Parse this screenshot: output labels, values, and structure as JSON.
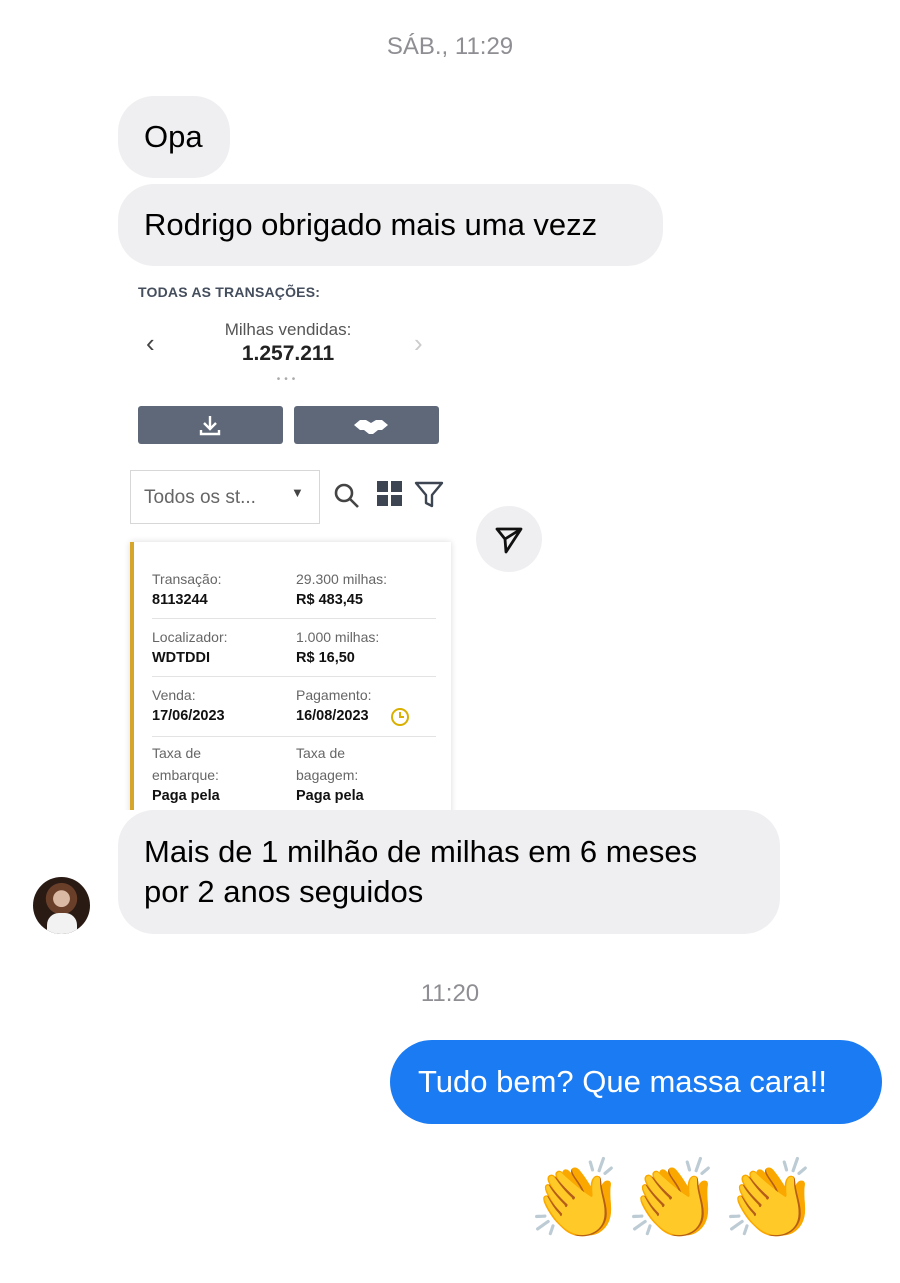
{
  "header": {
    "timestamp": "SÁB., 11:29"
  },
  "messages": {
    "m1": "Opa",
    "m2": "Rodrigo obrigado mais uma vezz",
    "m3_line1": "Mais de 1 milhão de milhas  em 6 meses",
    "m3_line2": "por 2 anos seguidos",
    "timestamp2": "11:20",
    "m4": "Tudo bem? Que massa cara!!",
    "m5": "👏👏👏"
  },
  "shared_image": {
    "heading": "TODAS AS TRANSAÇÕES:",
    "miles_label": "Milhas vendidas:",
    "miles_value": "1.257.211",
    "select_value": "Todos os st...",
    "fields": {
      "transacao_label": "Transação:",
      "transacao_value": "8113244",
      "milhas_label": "29.300 milhas:",
      "milhas_value": "R$ 483,45",
      "localizador_label": "Localizador:",
      "localizador_value": "WDTDDI",
      "mil_label": "1.000 milhas:",
      "mil_value": "R$ 16,50",
      "venda_label": "Venda:",
      "venda_value": "17/06/2023",
      "pagamento_label": "Pagamento:",
      "pagamento_value": "16/08/2023",
      "taxa_embarque_label_1": "Taxa de",
      "taxa_embarque_label_2": "embarque:",
      "taxa_embarque_value": "Paga pela",
      "taxa_bagagem_label_1": "Taxa de",
      "taxa_bagagem_label_2": "bagagem:",
      "taxa_bagagem_value": "Paga pela"
    }
  },
  "colors": {
    "incoming_bubble": "#efeff1",
    "outgoing_bubble": "#1a7bf2",
    "card_accent": "#d6a62b",
    "button_gray": "#5e6879"
  },
  "icons": [
    "download-icon",
    "handshake-icon",
    "search-icon",
    "grid-icon",
    "filter-icon",
    "clock-icon",
    "send-icon",
    "chevron-left-icon",
    "chevron-right-icon",
    "caret-down-icon"
  ]
}
